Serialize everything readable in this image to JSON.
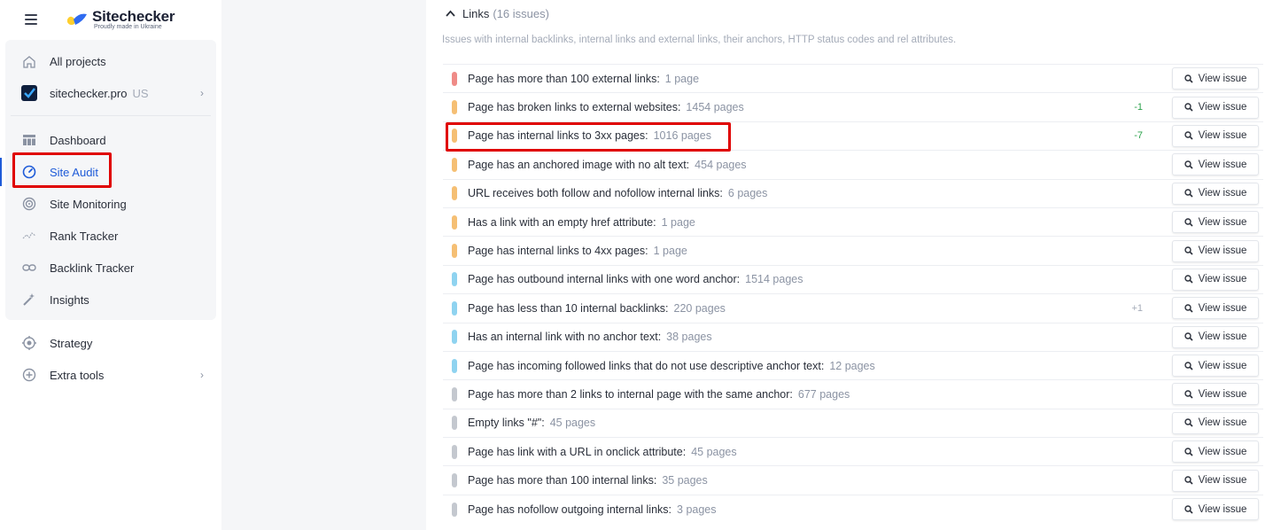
{
  "brand": {
    "name": "Sitechecker",
    "tagline": "Proudly made in Ukraine"
  },
  "sidebar": {
    "items": [
      {
        "label": "All projects",
        "icon": "home-icon"
      },
      {
        "label": "sitechecker.pro",
        "suffix": "US",
        "icon": "site-favicon-icon"
      },
      {
        "label": "Dashboard",
        "icon": "dashboard-icon"
      },
      {
        "label": "Site Audit",
        "icon": "gauge-icon",
        "active": true
      },
      {
        "label": "Site Monitoring",
        "icon": "radar-icon"
      },
      {
        "label": "Rank Tracker",
        "icon": "trend-icon"
      },
      {
        "label": "Backlink Tracker",
        "icon": "link-icon"
      },
      {
        "label": "Insights",
        "icon": "magic-wand-icon"
      },
      {
        "label": "Strategy",
        "icon": "target-icon"
      },
      {
        "label": "Extra tools",
        "icon": "plus-circle-icon"
      }
    ]
  },
  "section": {
    "title": "Links",
    "count": "(16 issues)",
    "description": "Issues with internal backlinks, internal links and external links, their anchors, HTTP status codes and rel attributes."
  },
  "button_label": "View issue",
  "issues": [
    {
      "title": "Page has more than 100 external links:",
      "pages": "1 page",
      "delta": "",
      "color": "#ef8b87"
    },
    {
      "title": "Page has broken links to external websites:",
      "pages": "1454 pages",
      "delta": "-1",
      "color": "#f5bf74"
    },
    {
      "title": "Page has internal links to 3xx pages:",
      "pages": "1016 pages",
      "delta": "-7",
      "color": "#f5bf74"
    },
    {
      "title": "Page has an anchored image with no alt text:",
      "pages": "454 pages",
      "delta": "",
      "color": "#f5bf74"
    },
    {
      "title": "URL receives both follow and nofollow internal links:",
      "pages": "6 pages",
      "delta": "",
      "color": "#f5bf74"
    },
    {
      "title": "Has a link with an empty href attribute:",
      "pages": "1 page",
      "delta": "",
      "color": "#f5bf74"
    },
    {
      "title": "Page has internal links to 4xx pages:",
      "pages": "1 page",
      "delta": "",
      "color": "#f5bf74"
    },
    {
      "title": "Page has outbound internal links with one word anchor:",
      "pages": "1514 pages",
      "delta": "",
      "color": "#8fd3f0"
    },
    {
      "title": "Page has less than 10 internal backlinks:",
      "pages": "220 pages",
      "delta": "+1",
      "color": "#8fd3f0"
    },
    {
      "title": "Has an internal link with no anchor text:",
      "pages": "38 pages",
      "delta": "",
      "color": "#8fd3f0"
    },
    {
      "title": "Page has incoming followed links that do not use descriptive anchor text:",
      "pages": "12 pages",
      "delta": "",
      "color": "#8fd3f0"
    },
    {
      "title": "Page has more than 2 links to internal page with the same anchor:",
      "pages": "677 pages",
      "delta": "",
      "color": "#c4c8cf"
    },
    {
      "title": "Empty links \"#\":",
      "pages": "45 pages",
      "delta": "",
      "color": "#c4c8cf"
    },
    {
      "title": "Page has link with a URL in onclick attribute:",
      "pages": "45 pages",
      "delta": "",
      "color": "#c4c8cf"
    },
    {
      "title": "Page has more than 100 internal links:",
      "pages": "35 pages",
      "delta": "",
      "color": "#c4c8cf"
    },
    {
      "title": "Page has nofollow outgoing internal links:",
      "pages": "3 pages",
      "delta": "",
      "color": "#c4c8cf"
    }
  ],
  "colors": {
    "accent": "#1e5bd8",
    "highlight_box": "#e00000",
    "delta_positive": "#2aa24a"
  }
}
